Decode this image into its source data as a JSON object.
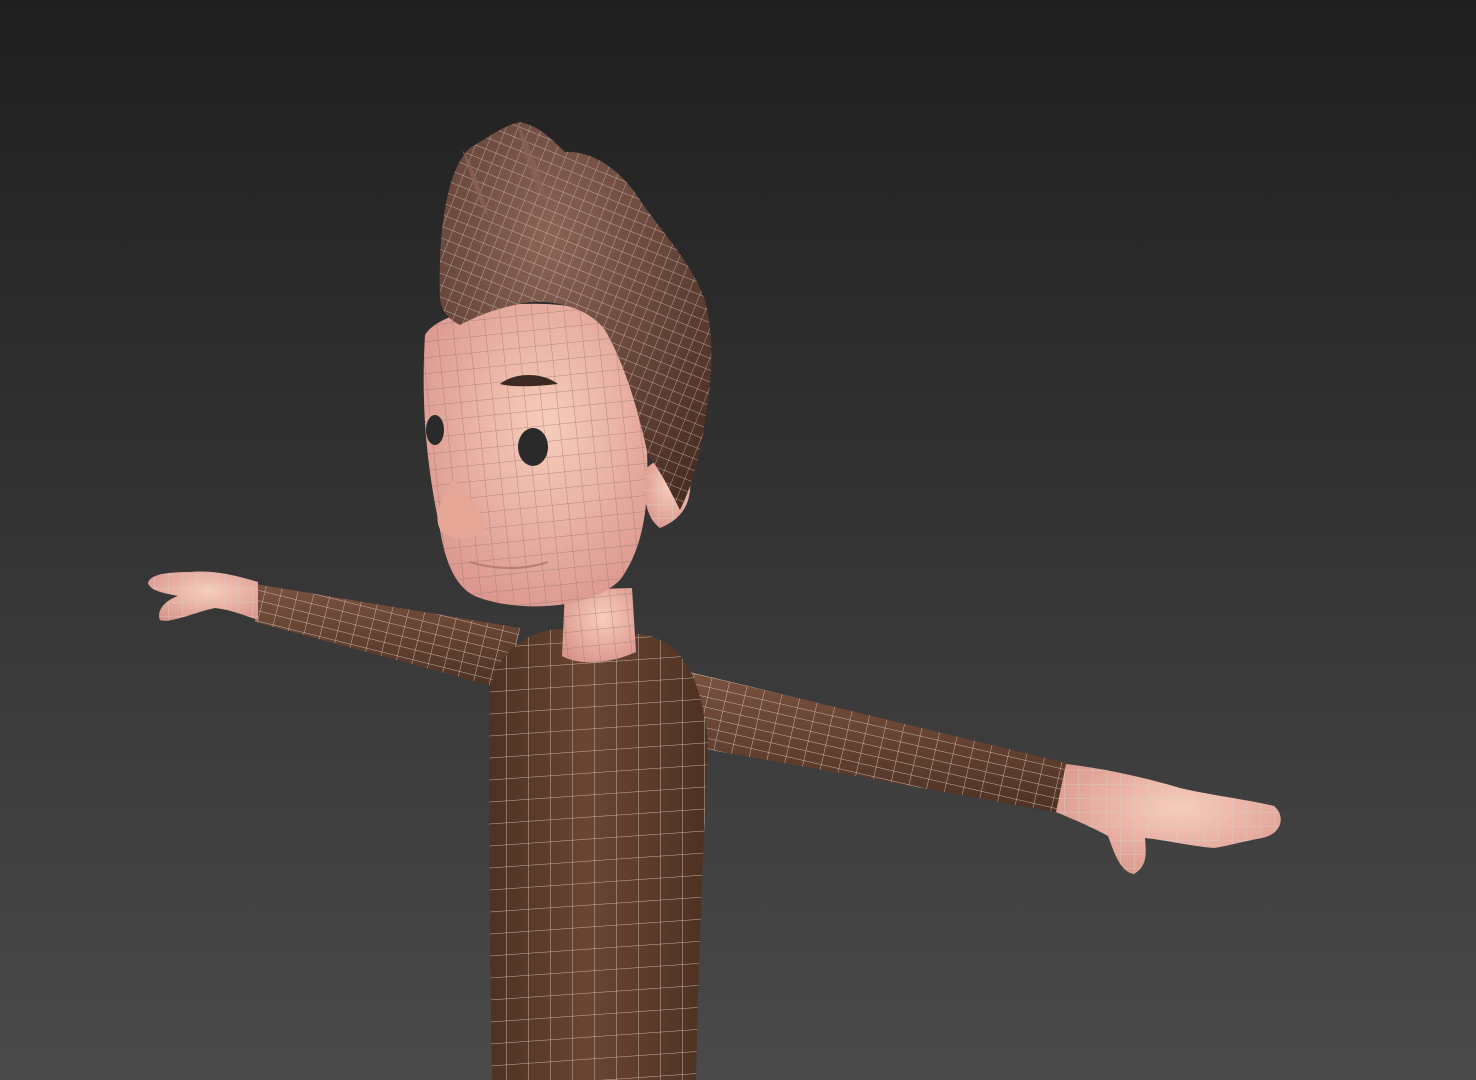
{
  "viewport": {
    "shading_mode": "wireframe-on-shaded",
    "subject": "character-model",
    "background_top": "#1f1f1f",
    "background_bottom": "#4a4a4a"
  },
  "colors": {
    "skin": "#f0b9a6",
    "skin_shadow": "#d9938a",
    "shirt": "#6a4532",
    "shirt_shadow": "#4e3122",
    "hair": "#5a3a2e",
    "hair_highlight": "#8b6355",
    "eye": "#2a2a2a",
    "brow": "#3d2a24",
    "wire": "#d9d0c8"
  },
  "icons": {
    "model": "character-mesh-icon"
  }
}
